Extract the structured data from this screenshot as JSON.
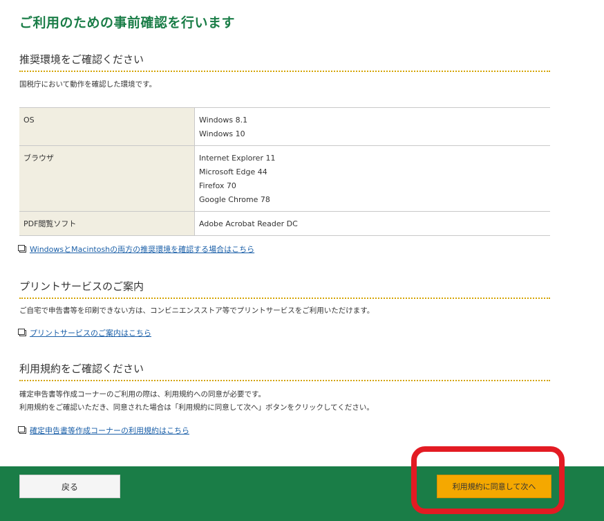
{
  "page": {
    "title": "ご利用のための事前確認を行います"
  },
  "env_section": {
    "heading": "推奨環境をご確認ください",
    "description": "国税庁において動作を確認した環境です。",
    "rows": [
      {
        "label": "OS",
        "values": [
          "Windows 8.1",
          "Windows 10"
        ]
      },
      {
        "label": "ブラウザ",
        "values": [
          "Internet Explorer 11",
          "Microsoft Edge 44",
          "Firefox 70",
          "Google Chrome 78"
        ]
      },
      {
        "label": "PDF閲覧ソフト",
        "values": [
          "Adobe Acrobat Reader DC"
        ]
      }
    ],
    "link": "WindowsとMacintoshの両方の推奨環境を確認する場合はこちら"
  },
  "print_section": {
    "heading": "プリントサービスのご案内",
    "description": "ご自宅で申告書等を印刷できない方は、コンビニエンスストア等でプリントサービスをご利用いただけます。",
    "link": "プリントサービスのご案内はこちら"
  },
  "terms_section": {
    "heading": "利用規約をご確認ください",
    "description_line1": "確定申告書等作成コーナーのご利用の際は、利用規約への同意が必要です。",
    "description_line2": "利用規約をご確認いただき、同意された場合は「利用規約に同意して次へ」ボタンをクリックしてください。",
    "link": "確定申告書等作成コーナーの利用規約はこちら"
  },
  "footer": {
    "back_label": "戻る",
    "agree_label": "利用規約に同意して次へ"
  },
  "colors": {
    "brand_green": "#1a7d47",
    "heading_underline": "#d4a300",
    "agree_button": "#f5a800",
    "highlight": "#e31b23",
    "table_label_bg": "#f1eee1"
  }
}
